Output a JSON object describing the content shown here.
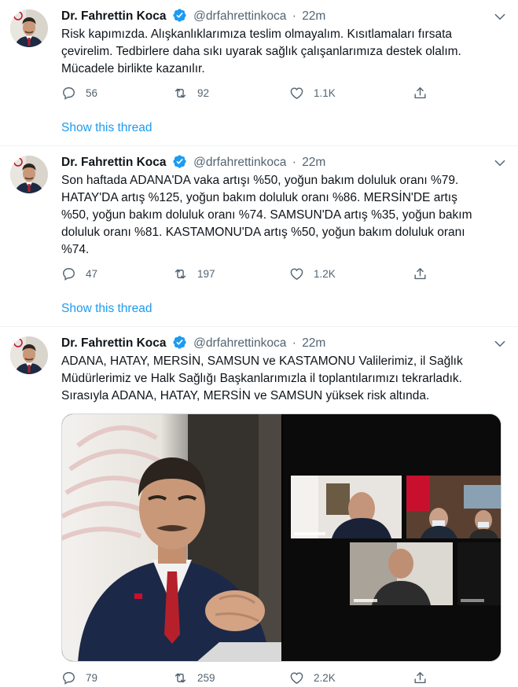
{
  "colors": {
    "accent": "#1d9bf0",
    "muted": "#536471",
    "text": "#0f1419",
    "verified": "#1d9bf0"
  },
  "tweets": [
    {
      "name": "Dr. Fahrettin Koca",
      "handle": "@drfahrettinkoca",
      "dot": "·",
      "time": "22m",
      "lines": [
        "Risk kapımızda. Alışkanlıklarımıza teslim olmayalım. Kısıtlamaları fırsata",
        "çevirelim. Tedbirlere daha sıkı uyarak sağlık çalışanlarımıza destek olalım.",
        "Mücadele birlikte kazanılır."
      ],
      "replies": "56",
      "retweets": "92",
      "likes": "1.1K",
      "show_thread": "Show this thread"
    },
    {
      "name": "Dr. Fahrettin Koca",
      "handle": "@drfahrettinkoca",
      "dot": "·",
      "time": "22m",
      "lines": [
        "Son haftada ADANA'DA vaka artışı %50, yoğun bakım doluluk oranı %79.",
        "HATAY'DA artış %125, yoğun bakım doluluk oranı %86. MERSİN'DE artış",
        "%50, yoğun bakım doluluk oranı %74. SAMSUN'DA artış %35, yoğun bakım",
        "doluluk oranı %81. KASTAMONU'DA artış %50, yoğun bakım doluluk oranı",
        "%74."
      ],
      "replies": "47",
      "retweets": "197",
      "likes": "1.2K",
      "show_thread": "Show this thread"
    },
    {
      "name": "Dr. Fahrettin Koca",
      "handle": "@drfahrettinkoca",
      "dot": "·",
      "time": "22m",
      "lines": [
        "ADANA, HATAY, MERSİN, SAMSUN ve KASTAMONU Valilerimiz, il Sağlık",
        "Müdürlerimiz ve Halk Sağlığı Başkanlarımızla il toplantılarımızı tekrarladık.",
        "Sırasıyla ADANA, HATAY, MERSİN ve SAMSUN yüksek risk altında."
      ],
      "replies": "79",
      "retweets": "259",
      "likes": "2.2K"
    }
  ],
  "icons": {
    "reply": "reply-icon",
    "retweet": "retweet-icon",
    "like": "heart-icon",
    "share": "share-icon",
    "caret": "chevron-down-icon",
    "verified": "verified-badge-icon"
  }
}
